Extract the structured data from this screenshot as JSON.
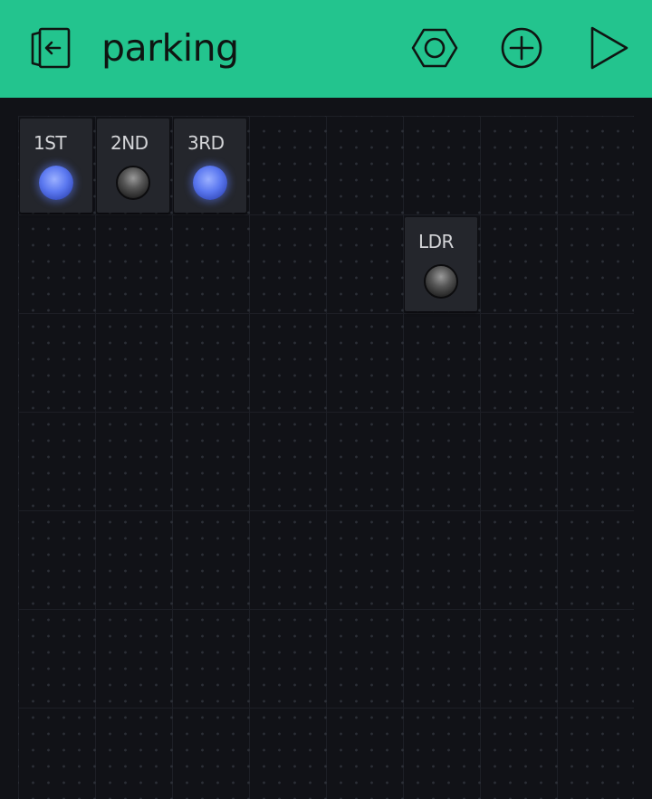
{
  "header": {
    "title": "parking",
    "icons": {
      "back": "exit-icon",
      "settings": "hexagon-nut-icon",
      "add": "plus-circle-icon",
      "play": "play-icon"
    },
    "background_color": "#23C48E"
  },
  "widgets": [
    {
      "label": "1ST",
      "state": "on"
    },
    {
      "label": "2ND",
      "state": "off"
    },
    {
      "label": "3RD",
      "state": "on"
    },
    {
      "label": "LDR",
      "state": "off"
    }
  ],
  "colors": {
    "canvas": "#111217",
    "widget": "#24262c",
    "led_on": "#5b78f0",
    "led_off": "#2a2a2a"
  }
}
